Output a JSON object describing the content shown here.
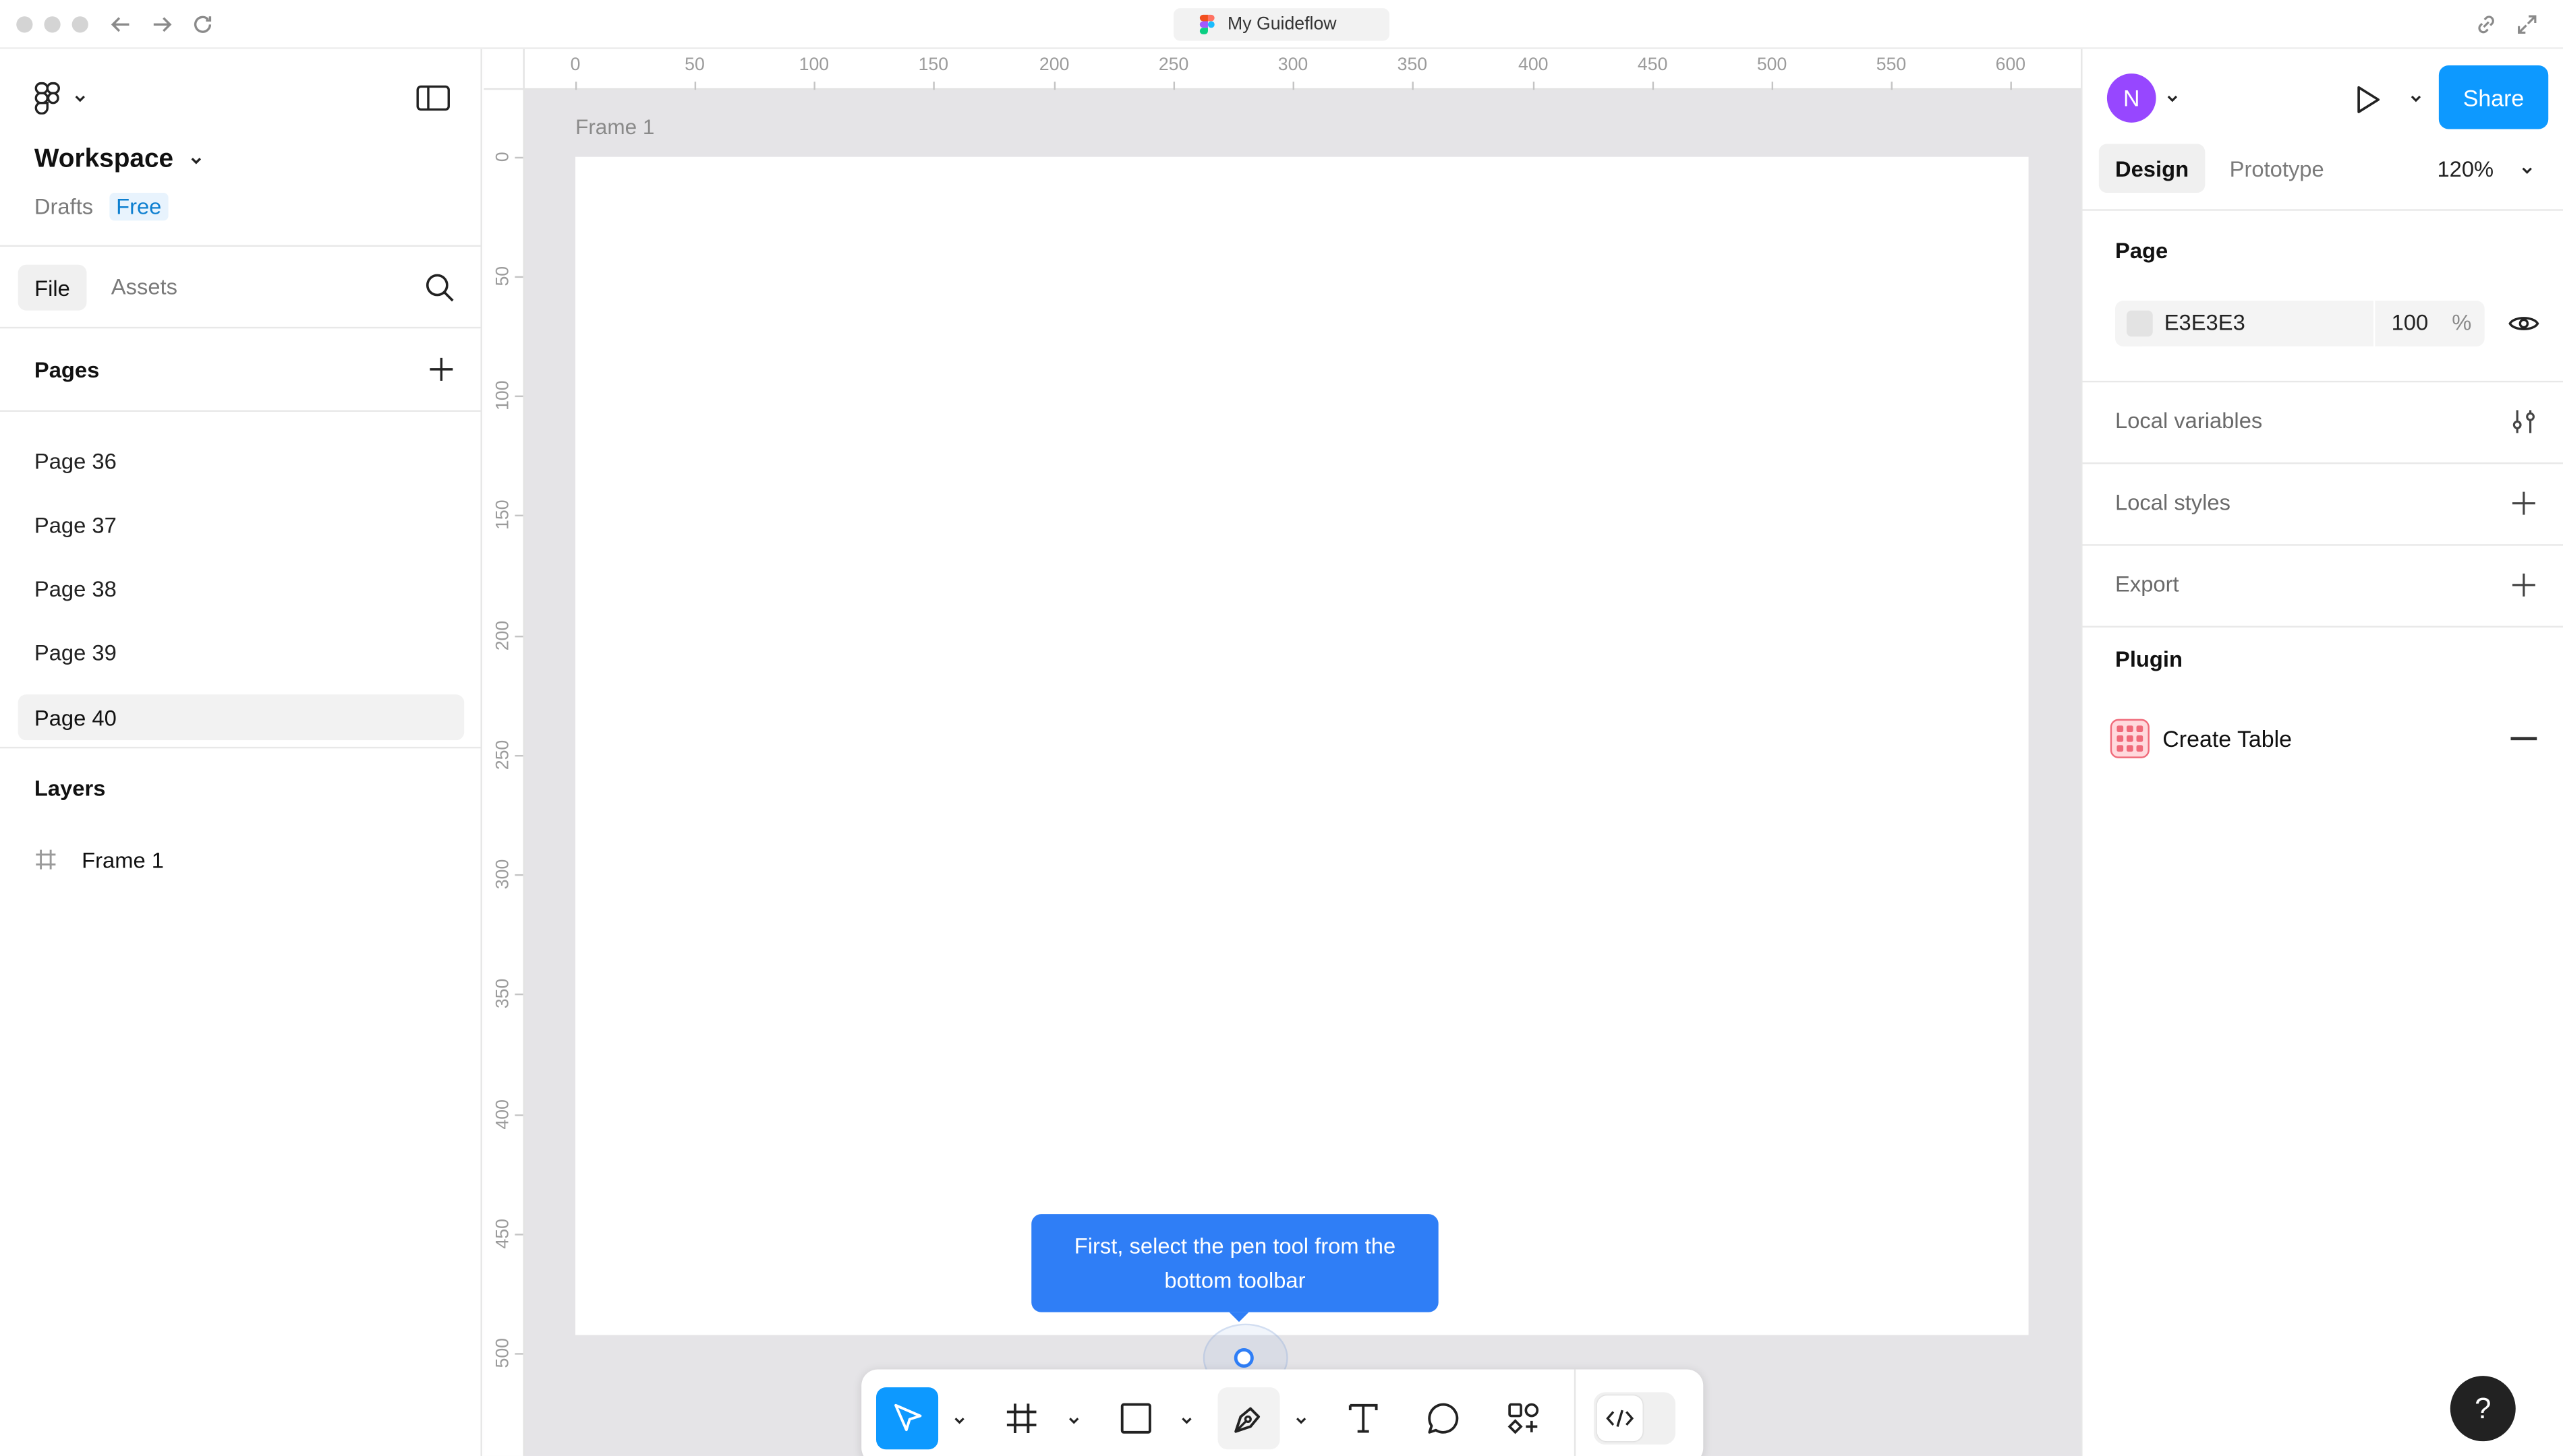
{
  "window": {
    "tab_title": "My Guideflow"
  },
  "sidebar": {
    "workspace_name": "Workspace",
    "drafts_label": "Drafts",
    "plan_badge": "Free",
    "tabs": {
      "file": "File",
      "assets": "Assets"
    },
    "pages_heading": "Pages",
    "pages": [
      {
        "label": "Page 36"
      },
      {
        "label": "Page 37"
      },
      {
        "label": "Page 38"
      },
      {
        "label": "Page 39"
      },
      {
        "label": "Page 40",
        "selected": true
      }
    ],
    "layers_heading": "Layers",
    "layers": [
      {
        "label": "Frame 1",
        "icon": "frame-hash-icon"
      }
    ]
  },
  "canvas": {
    "ruler_h_ticks": [
      "0",
      "50",
      "100",
      "150",
      "200",
      "250",
      "300",
      "350",
      "400",
      "450",
      "500",
      "550",
      "600"
    ],
    "ruler_v_ticks": [
      "0",
      "50",
      "100",
      "150",
      "200",
      "250",
      "300",
      "350",
      "400",
      "450",
      "500"
    ],
    "frame_label": "Frame 1",
    "frame_fill": "#FFFFFF",
    "canvas_bg": "#E5E4E7",
    "tooltip_text": "First, select the pen tool from the bottom toolbar",
    "tooltip_color": "#2F7EF6"
  },
  "toolbar": {
    "tools": [
      {
        "name": "move",
        "icon": "pointer-icon",
        "active": true
      },
      {
        "name": "frame",
        "icon": "frame-icon"
      },
      {
        "name": "shape",
        "icon": "rectangle-icon"
      },
      {
        "name": "pen",
        "icon": "pen-icon",
        "highlighted": true
      },
      {
        "name": "text",
        "icon": "text-icon"
      },
      {
        "name": "comment",
        "icon": "comment-icon"
      },
      {
        "name": "actions",
        "icon": "actions-icon"
      },
      {
        "name": "dev-mode",
        "icon": "code-icon"
      }
    ]
  },
  "right_panel": {
    "avatar_initial": "N",
    "share_label": "Share",
    "tabs": {
      "design": "Design",
      "prototype": "Prototype"
    },
    "zoom": "120%",
    "page_heading": "Page",
    "page_color_hex": "E3E3E3",
    "page_opacity": "100",
    "page_opacity_unit": "%",
    "local_variables": "Local variables",
    "local_styles": "Local styles",
    "export": "Export",
    "plugin_heading": "Plugin",
    "plugin_name": "Create Table",
    "help_label": "?",
    "accent": "#0D99FF",
    "avatar_color": "#9747FF"
  }
}
